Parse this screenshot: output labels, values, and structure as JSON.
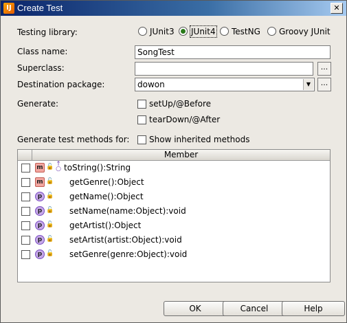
{
  "window": {
    "title": "Create Test",
    "app_icon": "intellij-icon",
    "close_glyph": "✕"
  },
  "testing_library": {
    "label": "Testing library:",
    "options": [
      {
        "label": "JUnit3",
        "selected": false
      },
      {
        "label": "JUnit4",
        "selected": true
      },
      {
        "label": "TestNG",
        "selected": false
      },
      {
        "label": "Groovy JUnit",
        "selected": false
      }
    ]
  },
  "class_name": {
    "label": "Class name:",
    "value": "SongTest"
  },
  "superclass": {
    "label": "Superclass:",
    "value": "",
    "browse_label": "..."
  },
  "destination_package": {
    "label": "Destination package:",
    "value": "dowon",
    "browse_label": "..."
  },
  "generate": {
    "label": "Generate:",
    "options": [
      {
        "label": "setUp/@Before",
        "checked": false
      },
      {
        "label": "tearDown/@After",
        "checked": false
      }
    ]
  },
  "methods_for": {
    "label": "Generate test methods for:",
    "show_inherited_label": "Show inherited methods",
    "show_inherited_checked": false
  },
  "members_table": {
    "header": "Member",
    "rows": [
      {
        "kind": "m",
        "signature": "toString():String",
        "checked": false,
        "override": true
      },
      {
        "kind": "m",
        "signature": "getGenre():Object",
        "checked": false,
        "override": false
      },
      {
        "kind": "p",
        "signature": "getName():Object",
        "checked": false,
        "override": false
      },
      {
        "kind": "p",
        "signature": "setName(name:Object):void",
        "checked": false,
        "override": false
      },
      {
        "kind": "p",
        "signature": "getArtist():Object",
        "checked": false,
        "override": false
      },
      {
        "kind": "p",
        "signature": "setArtist(artist:Object):void",
        "checked": false,
        "override": false
      },
      {
        "kind": "p",
        "signature": "setGenre(genre:Object):void",
        "checked": false,
        "override": false
      }
    ]
  },
  "buttons": {
    "ok": "OK",
    "cancel": "Cancel",
    "help": "Help"
  },
  "colors": {
    "title_bar": "#0a246a",
    "selected_radio": "#2a7a1a",
    "method_badge": "#f2a6a0",
    "property_badge": "#c6a9e8",
    "lock": "#2a8a3a"
  }
}
